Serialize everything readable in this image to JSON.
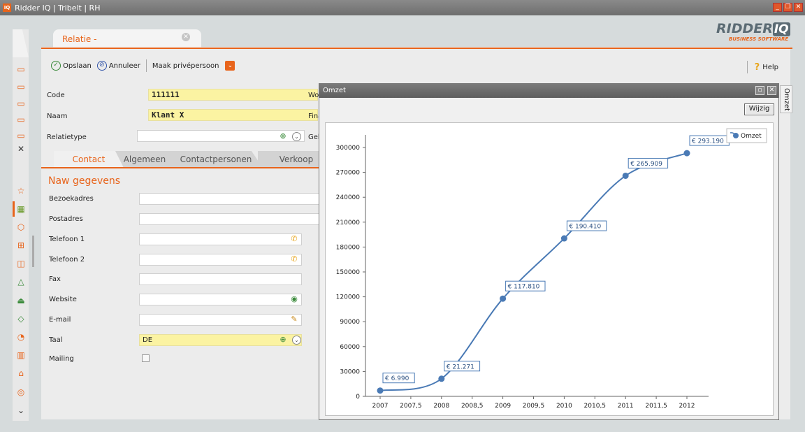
{
  "window": {
    "title": "Ridder IQ | Tribelt | RH",
    "app_icon": "IQ"
  },
  "logo": {
    "word": "RIDDER",
    "iq": "IQ",
    "sub": "BUSINESS SOFTWARE"
  },
  "doc_tab": {
    "label": "Relatie -"
  },
  "toolbar": {
    "save": "Opslaan",
    "cancel": "Annuleer",
    "private": "Maak privépersoon",
    "help": "Help"
  },
  "header_fields": {
    "code": {
      "label": "Code",
      "value": "111111"
    },
    "naam": {
      "label": "Naam",
      "value": "Klant X"
    },
    "relatietype": {
      "label": "Relatietype",
      "value": ""
    },
    "right_labels": [
      "Wo",
      "Fina",
      "Geb"
    ]
  },
  "subtabs": [
    "Contact",
    "Algemeen",
    "Contactpersonen",
    "Verkoop"
  ],
  "section_title": "Naw gegevens",
  "contact_fields": [
    {
      "label": "Bezoekadres",
      "value": ""
    },
    {
      "label": "Postadres",
      "value": ""
    },
    {
      "label": "Telefoon 1",
      "value": ""
    },
    {
      "label": "Telefoon 2",
      "value": ""
    },
    {
      "label": "Fax",
      "value": ""
    },
    {
      "label": "Website",
      "value": ""
    },
    {
      "label": "E-mail",
      "value": ""
    },
    {
      "label": "Taal",
      "value": "DE"
    },
    {
      "label": "Mailing",
      "value": ""
    }
  ],
  "omzet_window": {
    "title": "Omzet",
    "wijzig": "Wijzig",
    "side_tab": "Omzet"
  },
  "colors": {
    "accent": "#e8641b",
    "series": "#4a7ab5",
    "field_yellow": "#fbf3a2"
  },
  "chart_data": {
    "type": "line",
    "series": [
      {
        "name": "Omzet",
        "x": [
          2007,
          2008,
          2009,
          2010,
          2011,
          2012
        ],
        "values": [
          6990,
          21271,
          117810,
          190410,
          265909,
          293190
        ],
        "labels": [
          "€ 6.990",
          "€ 21.271",
          "€ 117.810",
          "€ 190.410",
          "€ 265.909",
          "€ 293.190"
        ]
      }
    ],
    "xticks": [
      "2007",
      "2007,5",
      "2008",
      "2008,5",
      "2009",
      "2009,5",
      "2010",
      "2010,5",
      "2011",
      "2011,5",
      "2012"
    ],
    "yticks": [
      "0",
      "30000",
      "60000",
      "90000",
      "120000",
      "150000",
      "180000",
      "210000",
      "240000",
      "270000",
      "300000"
    ],
    "xlim": [
      2007,
      2012
    ],
    "ylim": [
      0,
      300000
    ],
    "legend": "top-right",
    "grid": false,
    "smooth": true
  }
}
